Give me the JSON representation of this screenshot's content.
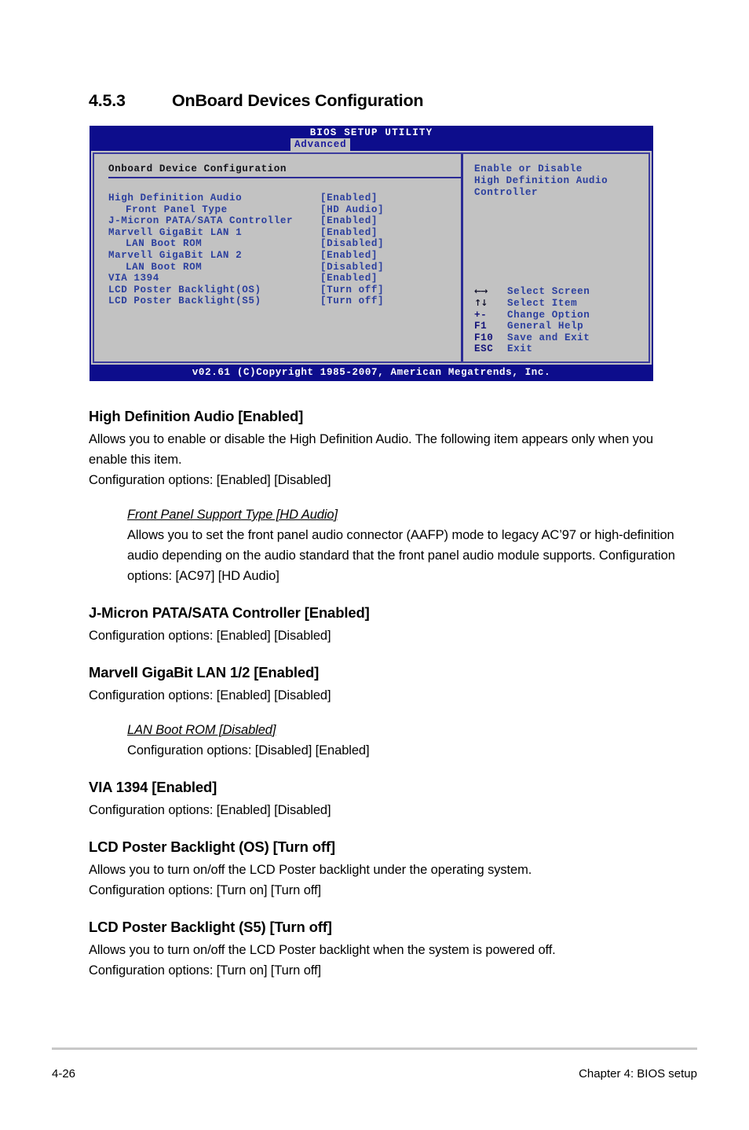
{
  "section": {
    "number": "4.5.3",
    "title": "OnBoard Devices Configuration"
  },
  "bios": {
    "title": "BIOS SETUP UTILITY",
    "tab": "Advanced",
    "panel_heading": "Onboard Device Configuration",
    "items": [
      {
        "label": "High Definition Audio",
        "value": "[Enabled]",
        "indent": false
      },
      {
        "label": "Front Panel Type",
        "value": "[HD Audio]",
        "indent": true
      },
      {
        "label": "J-Micron PATA/SATA Controller",
        "value": "[Enabled]",
        "indent": false
      },
      {
        "label": "Marvell GigaBit LAN 1",
        "value": "[Enabled]",
        "indent": false
      },
      {
        "label": "LAN Boot ROM",
        "value": "[Disabled]",
        "indent": true
      },
      {
        "label": "Marvell GigaBit LAN 2",
        "value": "[Enabled]",
        "indent": false
      },
      {
        "label": "LAN Boot ROM",
        "value": "[Disabled]",
        "indent": true
      },
      {
        "label": "VIA 1394",
        "value": "[Enabled]",
        "indent": false
      },
      {
        "label": "LCD Poster Backlight(OS)",
        "value": "[Turn off]",
        "indent": false
      },
      {
        "label": "LCD Poster Backlight(S5)",
        "value": "[Turn off]",
        "indent": false
      }
    ],
    "help": [
      "Enable or Disable",
      "High Definition Audio",
      "Controller"
    ],
    "legend": [
      {
        "key": "←→",
        "desc": "Select Screen",
        "glyph": true
      },
      {
        "key": "↑↓",
        "desc": "Select Item",
        "glyph": true
      },
      {
        "key": "+-",
        "desc": "Change Option",
        "glyph": false
      },
      {
        "key": "F1",
        "desc": "General Help",
        "glyph": false
      },
      {
        "key": "F10",
        "desc": "Save and Exit",
        "glyph": false
      },
      {
        "key": "ESC",
        "desc": "Exit",
        "glyph": false
      }
    ],
    "footer": "v02.61 (C)Copyright 1985-2007, American Megatrends, Inc."
  },
  "body": {
    "s1": {
      "title": "High Definition Audio [Enabled]",
      "p1": "Allows you to enable or disable the High Definition Audio. The following item appears only when you enable this item.",
      "p2": "Configuration options: [Enabled] [Disabled]",
      "sub_title": "Front Panel Support Type [HD Audio]",
      "sub_p": "Allows you to set the front panel audio connector (AAFP) mode to legacy AC’97 or high-definition audio depending on the audio standard that the front panel audio module supports. Configuration options: [AC97] [HD Audio]"
    },
    "s2": {
      "title": "J-Micron PATA/SATA Controller [Enabled]",
      "p1": "Configuration options: [Enabled] [Disabled]"
    },
    "s3": {
      "title": "Marvell GigaBit LAN 1/2 [Enabled]",
      "p1": "Configuration options: [Enabled] [Disabled]",
      "sub_title": "LAN Boot ROM [Disabled]",
      "sub_p": "Configuration options: [Disabled] [Enabled]"
    },
    "s4": {
      "title": "VIA 1394 [Enabled]",
      "p1": "Configuration options: [Enabled] [Disabled]"
    },
    "s5": {
      "title": "LCD Poster Backlight (OS) [Turn off]",
      "p1": "Allows you to turn on/off the LCD Poster backlight under the operating system.",
      "p2": "Configuration options: [Turn on] [Turn off]"
    },
    "s6": {
      "title": "LCD Poster Backlight (S5) [Turn off]",
      "p1": "Allows you to turn on/off the LCD Poster backlight when the system is powered off.",
      "p2": "Configuration options: [Turn on] [Turn off]"
    }
  },
  "page_footer": {
    "page_number": "4-26",
    "chapter": "Chapter 4: BIOS setup"
  },
  "colors": {
    "bios_chrome": "#0d0d8c",
    "bios_panel": "#c2c2c2",
    "bios_text": "#2b3f9e",
    "bios_border": "#3c3c9e"
  }
}
